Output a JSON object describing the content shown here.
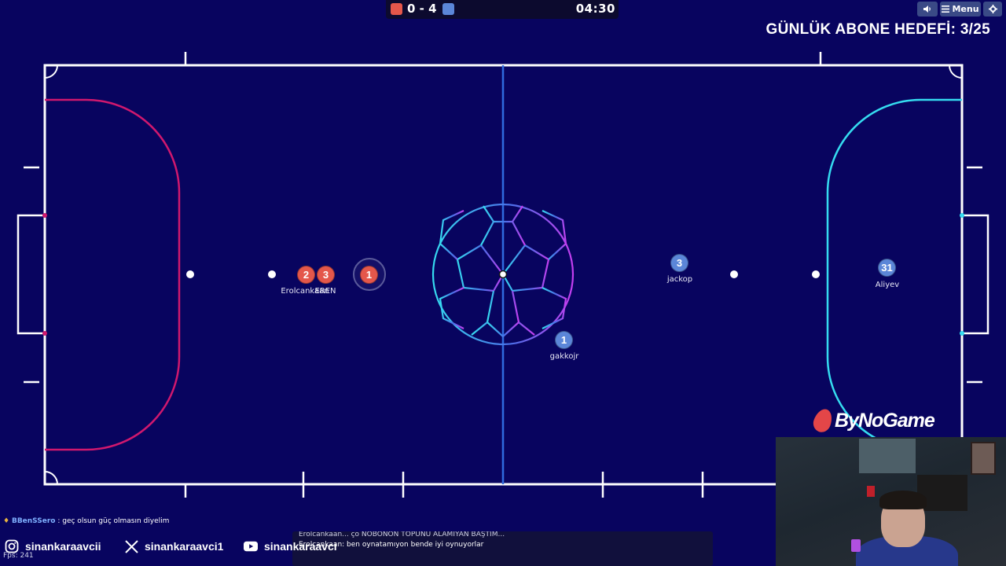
{
  "scoreboard": {
    "red_score": "0",
    "separator": "-",
    "blue_score": "4",
    "time": "04:30",
    "red_color": "#e4574b",
    "blue_color": "#5b86d8"
  },
  "top_buttons": {
    "sound_icon": "speaker-icon",
    "menu_label": "Menu",
    "settings_icon": "gear-icon"
  },
  "goal_banner": "GÜNLÜK ABONE HEDEFİ: 3/25",
  "players": {
    "red": [
      {
        "number": "2",
        "name": "Erolcankaan"
      },
      {
        "number": "3",
        "name": "EREN"
      },
      {
        "number": "1",
        "name": ""
      }
    ],
    "blue": [
      {
        "number": "3",
        "name": "jackop"
      },
      {
        "number": "31",
        "name": "Aliyev"
      },
      {
        "number": "1",
        "name": "gakkojr"
      }
    ]
  },
  "sponsor": "ByNoGame",
  "chat": {
    "user": "BBenSSero",
    "message": ": geç olsun güç olmasın diyelim"
  },
  "chatbox": {
    "line1": "Erolcankaan... çö NOBONON TOPUNU ALAMIYAN BAŞTIM...",
    "line2": "Erolcankaan: ben oynatamıyon bende iyi oynuyorlar"
  },
  "socials": [
    {
      "icon": "instagram-icon",
      "handle": "sinankaraavcii"
    },
    {
      "icon": "x-icon",
      "handle": "sinankaraavci1"
    },
    {
      "icon": "youtube-icon",
      "handle": "sinankaraavci"
    }
  ],
  "fps": "Fps: 241",
  "colors": {
    "field_bg": "#08045f",
    "left_area": "#d0186e",
    "right_area": "#35dcf0",
    "center_line": "#2f6ae0"
  }
}
